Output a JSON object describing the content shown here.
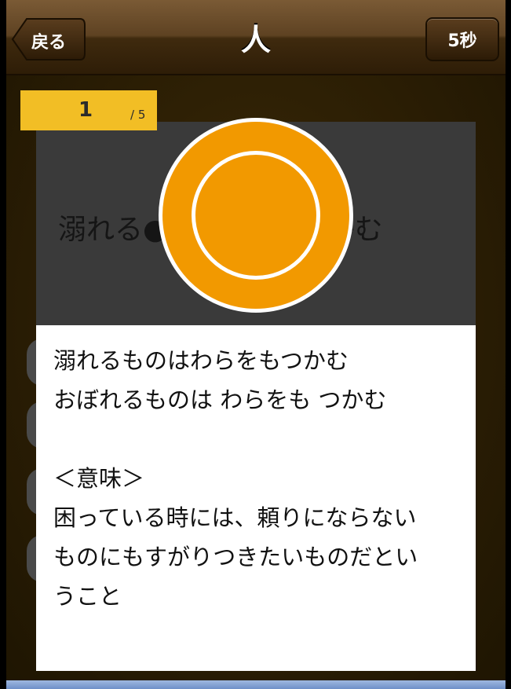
{
  "header": {
    "title": "人",
    "back_label": "戻る",
    "timer_label": "5秒"
  },
  "counter": {
    "current": "1",
    "total": "/ 5"
  },
  "question": {
    "text": "溺れる●●は●を●つかむ"
  },
  "answer": {
    "lines": [
      "溺れるものはわらをもつかむ",
      "おぼれるものは わらをも つかむ",
      "＜意味＞",
      "困っている時には、頼りにならない",
      "ものにもすがりつきたいものだとい",
      "うこと"
    ]
  },
  "colors": {
    "accent": "#f29900",
    "counter_bg": "#f2be25",
    "navbar": "#5e4222"
  }
}
